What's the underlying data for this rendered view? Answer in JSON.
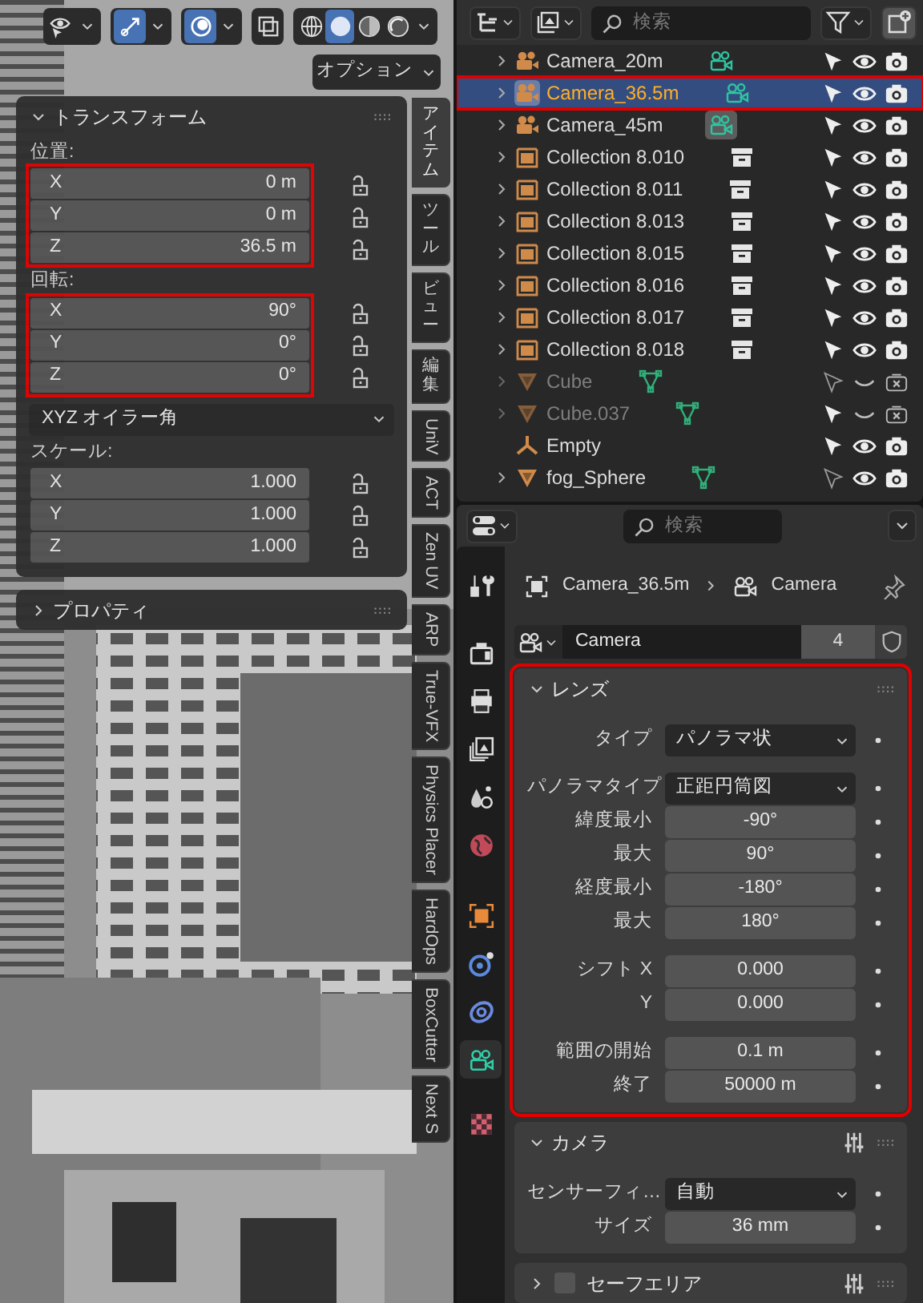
{
  "viewport": {
    "shading": [
      {
        "kind": "wireframe",
        "selected": false
      },
      {
        "kind": "solid",
        "selected": true
      },
      {
        "kind": "material",
        "selected": false
      },
      {
        "kind": "rendered",
        "selected": false
      }
    ],
    "options_label": "オプション",
    "transform": {
      "title": "トランスフォーム",
      "expanded": true,
      "sections": [
        {
          "kind": "vector",
          "label": "位置:",
          "highlighted": true,
          "fields": [
            {
              "axis": "X",
              "value": "0 m"
            },
            {
              "axis": "Y",
              "value": "0 m"
            },
            {
              "axis": "Z",
              "value": "36.5 m"
            }
          ]
        },
        {
          "kind": "vector",
          "label": "回転:",
          "highlighted": true,
          "fields": [
            {
              "axis": "X",
              "value": "90°"
            },
            {
              "axis": "Y",
              "value": "0°"
            },
            {
              "axis": "Z",
              "value": "0°"
            }
          ]
        },
        {
          "kind": "dropdown",
          "value": "XYZ オイラー角"
        },
        {
          "kind": "vector",
          "label": "スケール:",
          "highlighted": false,
          "fields": [
            {
              "axis": "X",
              "value": "1.000"
            },
            {
              "axis": "Y",
              "value": "1.000"
            },
            {
              "axis": "Z",
              "value": "1.000"
            }
          ]
        }
      ]
    },
    "properties_panel": {
      "title": "プロパティ",
      "expanded": false
    },
    "tabs": [
      {
        "label": "アイテム",
        "kind": "cjk",
        "selected": true
      },
      {
        "label": "ツール",
        "kind": "cjk",
        "selected": false
      },
      {
        "label": "ビュー",
        "kind": "cjk",
        "selected": false
      },
      {
        "label": "編集",
        "kind": "cjk",
        "selected": false
      },
      {
        "label": "UniV",
        "kind": "latin",
        "selected": false
      },
      {
        "label": "ACT",
        "kind": "latin",
        "selected": false
      },
      {
        "label": "Zen UV",
        "kind": "latin",
        "selected": false
      },
      {
        "label": "ARP",
        "kind": "latin",
        "selected": false
      },
      {
        "label": "True-VFX",
        "kind": "latin",
        "selected": false
      },
      {
        "label": "Physics Placer",
        "kind": "latin",
        "selected": false
      },
      {
        "label": "HardOps",
        "kind": "latin",
        "selected": false
      },
      {
        "label": "BoxCutter",
        "kind": "latin",
        "selected": false
      },
      {
        "label": "Next S",
        "kind": "latin",
        "selected": false
      }
    ]
  },
  "outliner": {
    "search_placeholder": "検索",
    "rows": [
      {
        "name": "Camera_20m",
        "kind": "camera",
        "expandable": true,
        "selected": false,
        "highlighted": false,
        "dimmed": false,
        "selectable": true,
        "visible": true,
        "renderable": true
      },
      {
        "name": "Camera_36.5m",
        "kind": "camera",
        "expandable": true,
        "selected": true,
        "highlighted": true,
        "dimmed": false,
        "selectable": true,
        "visible": true,
        "renderable": true
      },
      {
        "name": "Camera_45m",
        "kind": "camera",
        "expandable": true,
        "selected": false,
        "highlighted": false,
        "dimmed": false,
        "data_active": true,
        "selectable": true,
        "visible": true,
        "renderable": true
      },
      {
        "name": "Collection 8.010",
        "kind": "collection",
        "expandable": true,
        "selected": false,
        "highlighted": false,
        "dimmed": false,
        "selectable": true,
        "visible": true,
        "renderable": true
      },
      {
        "name": "Collection 8.011",
        "kind": "collection",
        "expandable": true,
        "selected": false,
        "highlighted": false,
        "dimmed": false,
        "selectable": true,
        "visible": true,
        "renderable": true
      },
      {
        "name": "Collection 8.013",
        "kind": "collection",
        "expandable": true,
        "selected": false,
        "highlighted": false,
        "dimmed": false,
        "selectable": true,
        "visible": true,
        "renderable": true
      },
      {
        "name": "Collection 8.015",
        "kind": "collection",
        "expandable": true,
        "selected": false,
        "highlighted": false,
        "dimmed": false,
        "selectable": true,
        "visible": true,
        "renderable": true
      },
      {
        "name": "Collection 8.016",
        "kind": "collection",
        "expandable": true,
        "selected": false,
        "highlighted": false,
        "dimmed": false,
        "selectable": true,
        "visible": true,
        "renderable": true
      },
      {
        "name": "Collection 8.017",
        "kind": "collection",
        "expandable": true,
        "selected": false,
        "highlighted": false,
        "dimmed": false,
        "selectable": true,
        "visible": true,
        "renderable": true
      },
      {
        "name": "Collection 8.018",
        "kind": "collection",
        "expandable": true,
        "selected": false,
        "highlighted": false,
        "dimmed": false,
        "selectable": true,
        "visible": true,
        "renderable": true
      },
      {
        "name": "Cube",
        "kind": "mesh",
        "expandable": true,
        "selected": false,
        "highlighted": false,
        "dimmed": true,
        "selectable": false,
        "visible": false,
        "renderable": false
      },
      {
        "name": "Cube.037",
        "kind": "mesh",
        "expandable": true,
        "selected": false,
        "highlighted": false,
        "dimmed": true,
        "selectable": true,
        "visible": false,
        "renderable": false
      },
      {
        "name": "Empty",
        "kind": "empty",
        "expandable": false,
        "selected": false,
        "highlighted": false,
        "dimmed": false,
        "selectable": true,
        "visible": true,
        "renderable": true
      },
      {
        "name": "fog_Sphere",
        "kind": "mesh",
        "expandable": true,
        "selected": false,
        "highlighted": false,
        "dimmed": false,
        "selectable": false,
        "visible": true,
        "renderable": true
      }
    ]
  },
  "properties": {
    "search_placeholder": "検索",
    "tabs": [
      {
        "kind": "tool",
        "selected": false
      },
      {
        "kind": "render",
        "selected": false
      },
      {
        "kind": "output",
        "selected": false
      },
      {
        "kind": "view_layer",
        "selected": false
      },
      {
        "kind": "scene",
        "selected": false
      },
      {
        "kind": "world",
        "selected": false
      },
      {
        "kind": "object",
        "selected": false
      },
      {
        "kind": "physics",
        "selected": false
      },
      {
        "kind": "constraints",
        "selected": false
      },
      {
        "kind": "camera_data",
        "selected": true
      },
      {
        "kind": "texture",
        "selected": false
      }
    ],
    "breadcrumb": [
      "Camera_36.5m",
      "Camera"
    ],
    "datablock": {
      "name": "Camera",
      "users": "4"
    },
    "panels": [
      {
        "title": "レンズ",
        "expanded": true,
        "highlighted": true,
        "has_presets": false,
        "groups": [
          {
            "rows": [
              {
                "kind": "dropdown",
                "label": "タイプ",
                "value": "パノラマ状"
              }
            ]
          },
          {
            "rows": [
              {
                "kind": "dropdown",
                "label": "パノラマタイプ",
                "value": "正距円筒図"
              },
              {
                "kind": "number",
                "label": "緯度最小",
                "value": "-90°"
              },
              {
                "kind": "number",
                "label": "最大",
                "value": "90°"
              },
              {
                "kind": "number",
                "label": "経度最小",
                "value": "-180°"
              },
              {
                "kind": "number",
                "label": "最大",
                "value": "180°"
              }
            ]
          },
          {
            "rows": [
              {
                "kind": "number",
                "label": "シフト X",
                "value": "0.000"
              },
              {
                "kind": "number",
                "label": "Y",
                "value": "0.000"
              }
            ]
          },
          {
            "rows": [
              {
                "kind": "number",
                "label": "範囲の開始",
                "value": "0.1 m"
              },
              {
                "kind": "number",
                "label": "終了",
                "value": "50000 m"
              }
            ]
          }
        ]
      },
      {
        "title": "カメラ",
        "expanded": true,
        "highlighted": false,
        "has_presets": true,
        "groups": [
          {
            "rows": [
              {
                "kind": "dropdown",
                "label": "センサーフィ…",
                "value": "自動"
              },
              {
                "kind": "number",
                "label": "サイズ",
                "value": "36 mm"
              }
            ]
          }
        ]
      },
      {
        "title": "セーフエリア",
        "expanded": false,
        "highlighted": false,
        "has_presets": true,
        "checkbox": {
          "checked": false
        }
      }
    ]
  }
}
